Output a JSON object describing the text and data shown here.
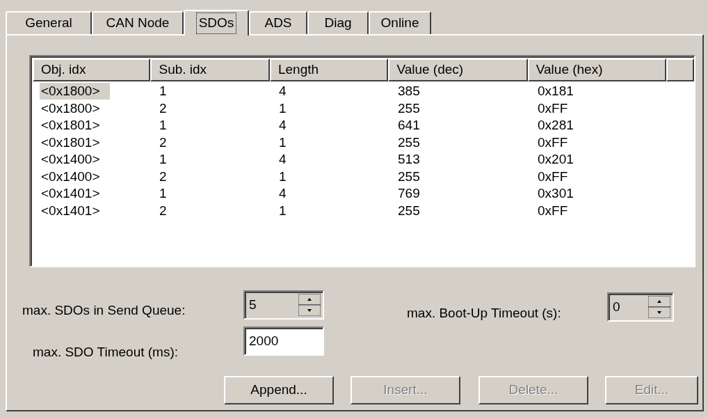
{
  "tabs": [
    {
      "label": "General",
      "selected": false
    },
    {
      "label": "CAN Node",
      "selected": false
    },
    {
      "label": "SDOs",
      "selected": true
    },
    {
      "label": "ADS",
      "selected": false
    },
    {
      "label": "Diag",
      "selected": false
    },
    {
      "label": "Online",
      "selected": false
    }
  ],
  "table": {
    "columns": [
      "Obj. idx",
      "Sub. idx",
      "Length",
      "Value (dec)",
      "Value (hex)"
    ],
    "rows": [
      {
        "cells": [
          "<0x1800>",
          "1",
          "4",
          "385",
          "0x181"
        ],
        "selected": true
      },
      {
        "cells": [
          "<0x1800>",
          "2",
          "1",
          "255",
          "0xFF"
        ],
        "selected": false
      },
      {
        "cells": [
          "<0x1801>",
          "1",
          "4",
          "641",
          "0x281"
        ],
        "selected": false
      },
      {
        "cells": [
          "<0x1801>",
          "2",
          "1",
          "255",
          "0xFF"
        ],
        "selected": false
      },
      {
        "cells": [
          "<0x1400>",
          "1",
          "4",
          "513",
          "0x201"
        ],
        "selected": false
      },
      {
        "cells": [
          "<0x1400>",
          "2",
          "1",
          "255",
          "0xFF"
        ],
        "selected": false
      },
      {
        "cells": [
          "<0x1401>",
          "1",
          "4",
          "769",
          "0x301"
        ],
        "selected": false
      },
      {
        "cells": [
          "<0x1401>",
          "2",
          "1",
          "255",
          "0xFF"
        ],
        "selected": false
      }
    ]
  },
  "settings": {
    "send_queue": {
      "label": "max. SDOs in Send Queue:",
      "value": "5"
    },
    "boot_up_timeout": {
      "label": "max. Boot-Up Timeout (s):",
      "value": "0"
    },
    "sdo_timeout": {
      "label": "max. SDO Timeout (ms):",
      "value": "2000"
    }
  },
  "buttons": [
    {
      "label": "Append...",
      "disabled": false
    },
    {
      "label": "Insert...",
      "disabled": true
    },
    {
      "label": "Delete...",
      "disabled": true
    },
    {
      "label": "Edit...",
      "disabled": true
    }
  ]
}
